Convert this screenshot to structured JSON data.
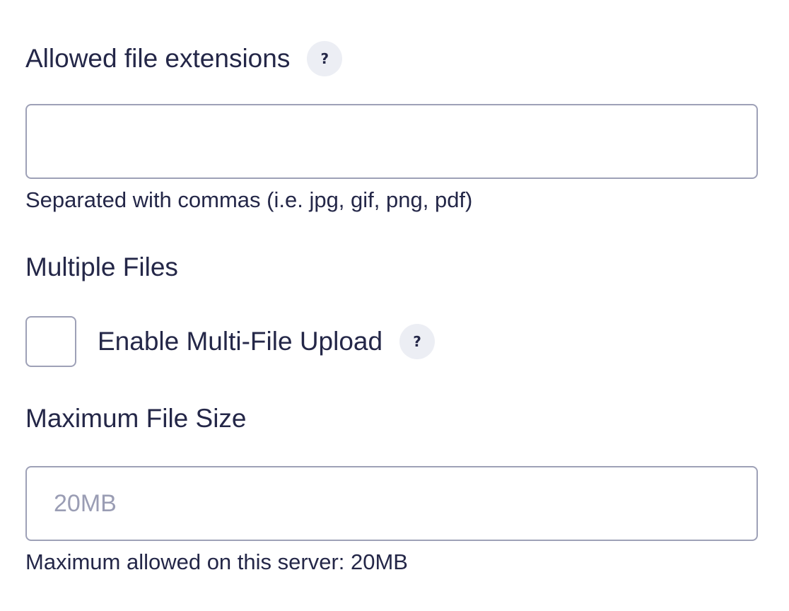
{
  "extensions": {
    "label": "Allowed file extensions",
    "help_icon": "question-mark-icon",
    "help_glyph": "?",
    "value": "",
    "placeholder": "",
    "hint": "Separated with commas (i.e. jpg, gif, png, pdf)"
  },
  "multiple_files": {
    "label": "Multiple Files",
    "checkbox_label": "Enable Multi-File Upload",
    "checked": false,
    "help_icon": "question-mark-icon",
    "help_glyph": "?"
  },
  "max_size": {
    "label": "Maximum File Size",
    "value": "",
    "placeholder": "20MB",
    "hint": "Maximum allowed on this server: 20MB"
  },
  "colors": {
    "text": "#242748",
    "border": "#9ea1b7",
    "placeholder": "#9a9db4",
    "help_badge_bg": "#eceef4"
  }
}
